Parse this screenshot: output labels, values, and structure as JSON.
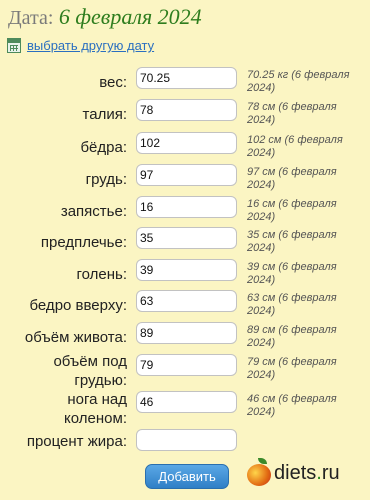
{
  "header": {
    "label": "Дата:",
    "date": "6 февраля 2024"
  },
  "choose_date": {
    "text": "выбрать другую дату"
  },
  "rows": [
    {
      "label": "вес:",
      "value": "70.25",
      "note": "70.25 кг (6 февраля 2024)"
    },
    {
      "label": "талия:",
      "value": "78",
      "note": "78 см (6 февраля 2024)"
    },
    {
      "label": "бёдра:",
      "value": "102",
      "note": "102 см (6 февраля 2024)"
    },
    {
      "label": "грудь:",
      "value": "97",
      "note": "97 см (6 февраля 2024)"
    },
    {
      "label": "запястье:",
      "value": "16",
      "note": "16 см (6 февраля 2024)"
    },
    {
      "label": "предплечье:",
      "value": "35",
      "note": "35 см (6 февраля 2024)"
    },
    {
      "label": "голень:",
      "value": "39",
      "note": "39 см (6 февраля 2024)"
    },
    {
      "label": "бедро вверху:",
      "value": "63",
      "note": "63 см (6 февраля 2024)"
    },
    {
      "label": "объём живота:",
      "value": "89",
      "note": "89 см (6 февраля 2024)"
    },
    {
      "label": "объём под грудью:",
      "value": "79",
      "note": "79 см (6 февраля 2024)"
    },
    {
      "label": "нога над коленом:",
      "value": "46",
      "note": "46 см (6 февраля 2024)"
    },
    {
      "label": "процент жира:",
      "value": "",
      "note": ""
    }
  ],
  "add_button": {
    "label": "Добавить"
  },
  "logo": {
    "name": "diets",
    "dot": ".",
    "tld": "ru"
  }
}
